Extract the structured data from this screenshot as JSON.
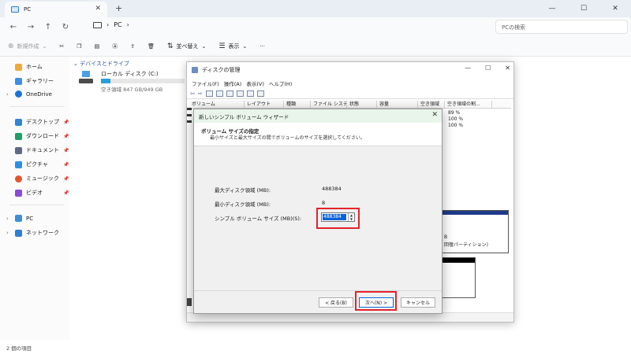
{
  "explorer": {
    "tab_title": "PC",
    "breadcrumb": "PC",
    "search_placeholder": "PCの検索",
    "commands": {
      "new": "新規作成",
      "sort": "並べ替え",
      "view": "表示",
      "more": "···"
    },
    "sidebar": {
      "home": "ホーム",
      "gallery": "ギャラリー",
      "onedrive": "OneDrive",
      "desktop": "デスクトップ",
      "downloads": "ダウンロード",
      "documents": "ドキュメント",
      "pictures": "ピクチャ",
      "music": "ミュージック",
      "videos": "ビデオ",
      "pc": "PC",
      "network": "ネットワーク"
    },
    "group_header": "デバイスとドライブ",
    "drive": {
      "name": "ローカル ディスク (C:)",
      "free_text": "空き領域 847 GB/949 GB",
      "used_fraction": 0.11
    },
    "status": "2 個の項目"
  },
  "disk_mgmt": {
    "title": "ディスクの管理",
    "menu": [
      "ファイル(F)",
      "操作(A)",
      "表示(V)",
      "ヘルプ(H)"
    ],
    "columns": [
      "ボリューム",
      "レイアウト",
      "種類",
      "ファイル システム",
      "状態",
      "容量",
      "空き領域",
      "空き領域の割..."
    ],
    "free_pct": [
      "89 %",
      "100 %",
      "100 %"
    ],
    "graph_text_1": "B",
    "graph_text_2": "回復パーティション)"
  },
  "wizard": {
    "title": "新しいシンプル ボリューム ウィザード",
    "heading": "ボリューム サイズの指定",
    "subheading": "最小サイズと最大サイズの間でボリュームのサイズを選択してください。",
    "max_label": "最大ディスク領域 (MB):",
    "max_value": "488384",
    "min_label": "最小ディスク領域 (MB):",
    "min_value": "8",
    "size_label": "シンプル ボリューム サイズ (MB)(S):",
    "size_value": "488384",
    "back_button": "< 戻る(B)",
    "next_button": "次へ(N) >",
    "cancel_button": "キャンセル"
  },
  "colors": {
    "highlight_box": "#e3232c",
    "selection": "#0a64d8",
    "wizard_title_bg": "#e9f5ea"
  }
}
